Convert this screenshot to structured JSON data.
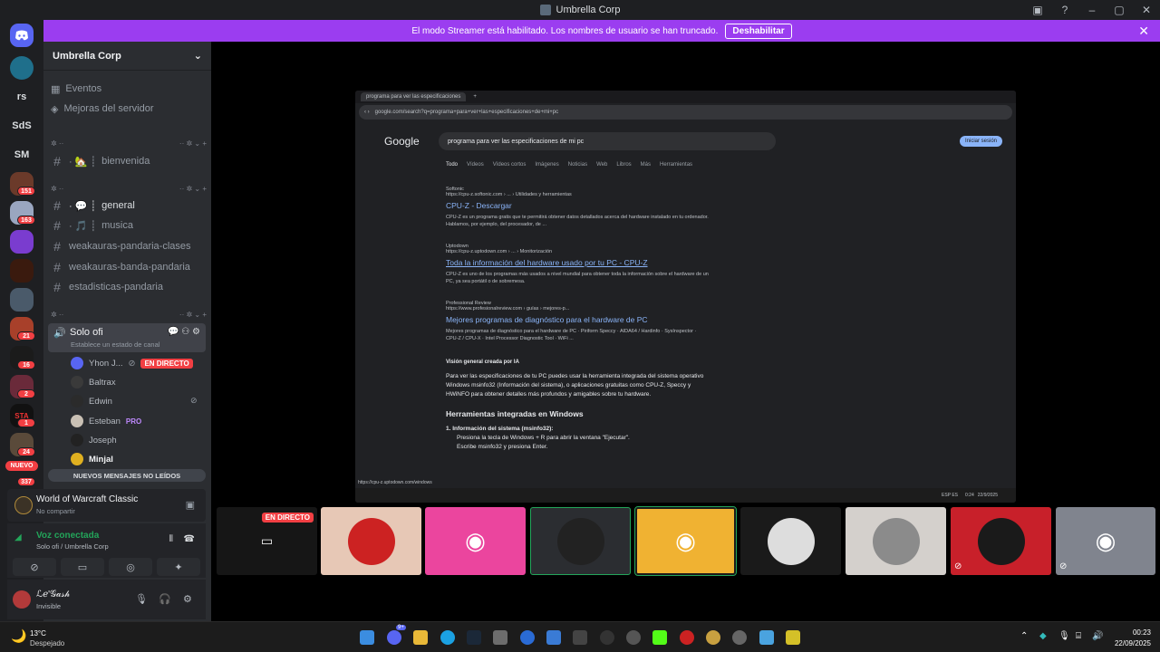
{
  "window": {
    "title": "Umbrella Corp"
  },
  "banner": {
    "text": "El modo Streamer está habilitado. Los nombres de usuario se han truncado.",
    "button": "Deshabilitar"
  },
  "rail": {
    "items": [
      {
        "label": "rs"
      },
      {
        "label": "SdS"
      },
      {
        "label": "SM"
      }
    ],
    "badges": [
      "151",
      "163",
      "21",
      "16",
      "2",
      "1",
      "24",
      "337"
    ],
    "new_label": "NUEVO"
  },
  "server": {
    "name": "Umbrella Corp",
    "menu": [
      "Eventos",
      "Mejoras del servidor"
    ],
    "channels": [
      {
        "name": "bienvenida",
        "prefix": "· 🏡 ┊"
      },
      {
        "name": "general",
        "prefix": "· 💬 ┊"
      },
      {
        "name": "musica",
        "prefix": "· 🎵 ┊"
      },
      {
        "name": "weakauras-pandaria-clases",
        "prefix": ""
      },
      {
        "name": "weakauras-banda-pandaria",
        "prefix": ""
      },
      {
        "name": "estadisticas-pandaria",
        "prefix": ""
      }
    ],
    "voice_channel": {
      "name": "Solo ofi",
      "status": "Establece un estado de canal"
    },
    "voice_users": [
      {
        "name": "Yhon J...",
        "live": "EN DIRECTO"
      },
      {
        "name": "Baltrax"
      },
      {
        "name": "Edwin"
      },
      {
        "name": "Esteban",
        "tag": "PRO"
      },
      {
        "name": "Joseph"
      },
      {
        "name": "Minjal"
      }
    ],
    "unread": "NUEVOS MENSAJES NO LEÍDOS"
  },
  "activity": {
    "game": "World of Warcraft Classic",
    "sub": "No compartir"
  },
  "voice_status": {
    "title": "Voz conectada",
    "sub": "Solo ofi / Umbrella Corp"
  },
  "user": {
    "name": "ℒℯ'𝒢𝒶𝓈𝒽",
    "status": "Invisible"
  },
  "stream": {
    "tab": "programa para ver las especificaciones",
    "url": "google.com/search?q=programa+para+ver+las+especificaciones+de+mi+pc",
    "query": "programa para ver las especificaciones de mi pc",
    "logo": "Google",
    "signin": "Iniciar sesión",
    "tabs": [
      "Todo",
      "Vídeos",
      "Vídeos cortos",
      "Imágenes",
      "Noticias",
      "Web",
      "Libros",
      "Más",
      "Herramientas"
    ],
    "results": [
      {
        "site": "Softonic",
        "url": "https://cpu-z.softonic.com › ... › Utilidades y herramientas",
        "title": "CPU-Z - Descargar",
        "snippet": "CPU-Z es un programa gratis que te permitirá obtener datos detallados acerca del hardware instalado en tu ordenador. Hablamos, por ejemplo, del procesador, de ..."
      },
      {
        "site": "Uptodown",
        "url": "https://cpu-z.uptodown.com › ... › Monitorización",
        "title": "Toda la información del hardware usado por tu PC - CPU-Z",
        "snippet": "CPU-Z es uno de los programas más usados a nivel mundial para obtener toda la información sobre el hardware de un PC, ya sea portátil o de sobremesa."
      },
      {
        "site": "Professional Review",
        "url": "https://www.profesionalreview.com › guías › mejores-p...",
        "title": "Mejores programas de diagnóstico para el hardware de PC",
        "snippet": "Mejores programas de diagnóstico para el hardware de PC · Piriform Speccy · AIDA64 / Hardinfo · SysInspector · CPU-Z / CPU-X · Intel Processor Diagnostic Tool · WiFi ..."
      }
    ],
    "ai_title": "Visión general creada por IA",
    "ai_text": "Para ver las especificaciones de tu PC puedes usar la herramienta integrada del sistema operativo Windows msinfo32 (Información del sistema), o aplicaciones gratuitas como CPU-Z, Speccy y HWiNFO para obtener detalles más profundos y amigables sobre tu hardware.",
    "ai_heading": "Herramientas integradas en Windows",
    "ai_list": "1. Información del sistema (msinfo32):",
    "ai_bullets": [
      "Presiona la tecla de Windows + R para abrir la ventana \"Ejecutar\".",
      "Escribe msinfo32 y presiona Enter."
    ],
    "status_url": "https://cpu-z.uptodown.com/windows",
    "tray": {
      "lang": "ESP ES",
      "time": "0:24",
      "date": "22/9/2025"
    }
  },
  "tiles": {
    "live": "EN DIRECTO"
  },
  "taskbar": {
    "weather_temp": "13°C",
    "weather_desc": "Despejado",
    "time": "00:23",
    "date": "22/09/2025",
    "discord_badge": "9+"
  }
}
